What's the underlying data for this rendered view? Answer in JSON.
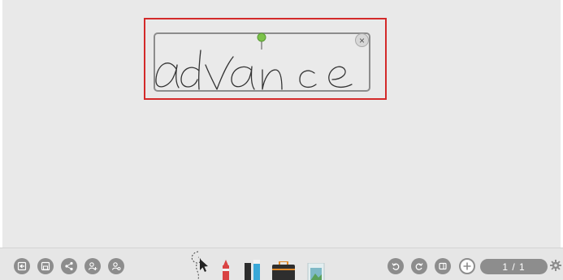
{
  "note": {
    "handwriting": "advance",
    "close_glyph": "×"
  },
  "toolbar": {
    "left_icons": [
      "exit-icon",
      "save-icon",
      "share-icon",
      "add-user-icon",
      "user-settings-icon"
    ],
    "tools": [
      "lasso-select-icon",
      "pen-tool-icon",
      "eraser-tool-icon",
      "toolbox-icon",
      "image-insert-icon"
    ],
    "right_icons": [
      "undo-icon",
      "redo-icon",
      "fullscreen-icon",
      "add-page-icon",
      "settings-gear-icon"
    ],
    "page_indicator": "1 / 1"
  },
  "colors": {
    "canvas": "#e9e9e9",
    "selection_border": "#d32a2a",
    "toolbar_icon": "#8d8d8d",
    "pin": "#7cc24a"
  }
}
